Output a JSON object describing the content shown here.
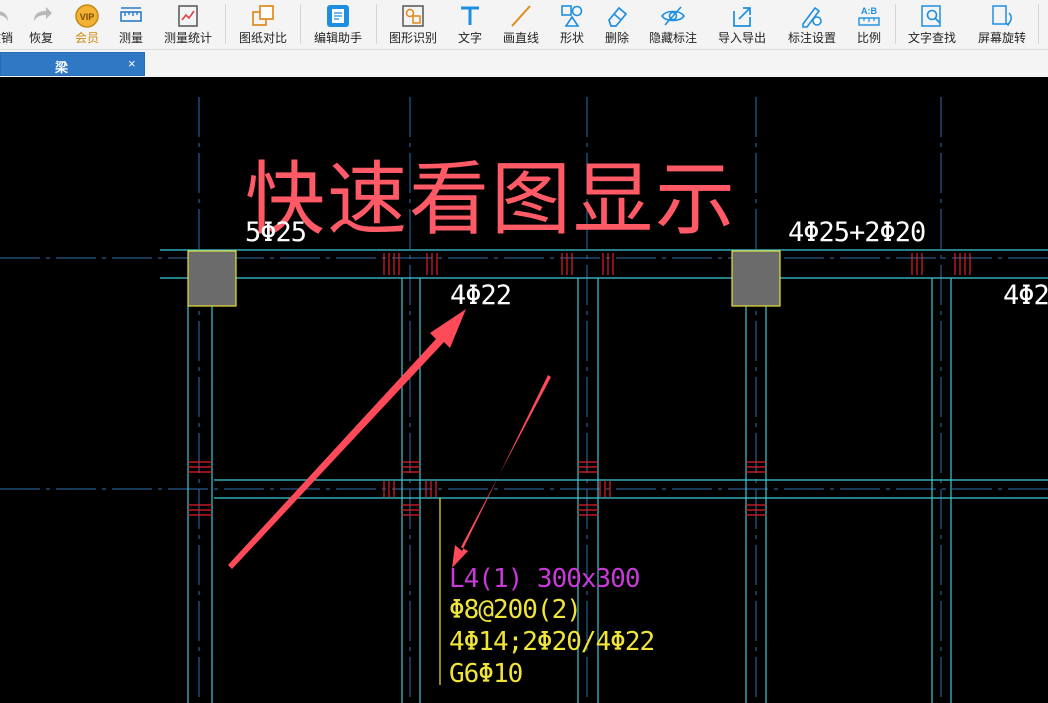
{
  "toolbar": {
    "items": [
      {
        "label": "撤销",
        "icon": "undo-icon"
      },
      {
        "label": "恢复",
        "icon": "redo-icon"
      },
      {
        "label": "会员",
        "icon": "vip-icon"
      },
      {
        "label": "测量",
        "icon": "ruler-icon"
      },
      {
        "label": "测量统计",
        "icon": "measure-stats-icon"
      },
      {
        "label": "图纸对比",
        "icon": "compare-icon"
      },
      {
        "label": "编辑助手",
        "icon": "edit-assistant-icon"
      },
      {
        "label": "图形识别",
        "icon": "shape-recognition-icon"
      },
      {
        "label": "文字",
        "icon": "text-icon"
      },
      {
        "label": "画直线",
        "icon": "line-icon"
      },
      {
        "label": "形状",
        "icon": "shape-icon"
      },
      {
        "label": "删除",
        "icon": "eraser-icon"
      },
      {
        "label": "隐藏标注",
        "icon": "hide-eye-icon"
      },
      {
        "label": "导入导出",
        "icon": "import-export-icon"
      },
      {
        "label": "标注设置",
        "icon": "annotation-settings-icon"
      },
      {
        "label": "比例",
        "icon": "scale-icon"
      },
      {
        "label": "文字查找",
        "icon": "text-search-icon"
      },
      {
        "label": "屏幕旋转",
        "icon": "rotate-screen-icon"
      }
    ],
    "vip_badge": "VIP",
    "scale_badge": "A:B"
  },
  "tab": {
    "title": "梁",
    "close": "×"
  },
  "canvas": {
    "overlay_title": "快速看图显示",
    "annotations": {
      "top_left_rebar": "5Φ25",
      "top_right_rebar": "4Φ25+2Φ20",
      "mid_rebar": "4Φ22",
      "right_edge_rebar": "4Φ2",
      "beam_id": "L4(1) 300x300",
      "stirrup": "Φ8@200(2)",
      "main_rebar": "4Φ14;2Φ20/4Φ22",
      "side_rebar": "G6Φ10"
    },
    "colors": {
      "background": "#000000",
      "axis_line": "#2f6fb0",
      "beam_line": "#3cc9d6",
      "column_fill": "#6b6b6b",
      "column_border": "#e8e23a",
      "hatch": "#e0202a",
      "annotation_white": "#ffffff",
      "annotation_magenta": "#c83ad8",
      "annotation_yellow": "#f0e43a",
      "arrow": "#ff4a5a"
    }
  }
}
